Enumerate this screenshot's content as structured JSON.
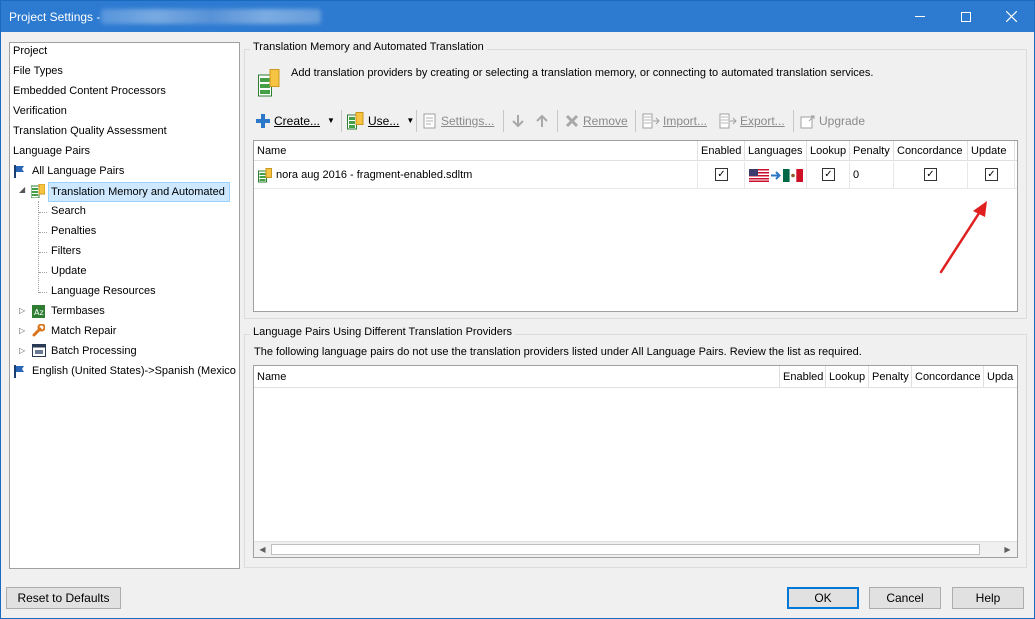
{
  "window": {
    "title": "Project Settings -",
    "colors": {
      "titlebar": "#2d7ad1",
      "accent": "#0078d7",
      "selection": "#cde8ff",
      "arrow": "#e02020"
    }
  },
  "tree": {
    "items": [
      {
        "label": "Project"
      },
      {
        "label": "File Types"
      },
      {
        "label": "Embedded Content Processors"
      },
      {
        "label": "Verification"
      },
      {
        "label": "Translation Quality Assessment"
      },
      {
        "label": "Language Pairs"
      },
      {
        "label": "All Language Pairs"
      },
      {
        "label": "Translation Memory and Automated"
      },
      {
        "label": "Search"
      },
      {
        "label": "Penalties"
      },
      {
        "label": "Filters"
      },
      {
        "label": "Update"
      },
      {
        "label": "Language Resources"
      },
      {
        "label": "Termbases"
      },
      {
        "label": "Match Repair"
      },
      {
        "label": "Batch Processing"
      },
      {
        "label": "English (United States)->Spanish (Mexico"
      }
    ]
  },
  "tm_section": {
    "title": "Translation Memory and Automated Translation",
    "description": "Add translation providers by creating or selecting a translation memory, or connecting to automated translation services."
  },
  "toolbar": {
    "create": "Create...",
    "use": "Use...",
    "settings": "Settings...",
    "remove": "Remove",
    "import": "Import...",
    "export": "Export...",
    "upgrade": "Upgrade"
  },
  "tm_grid": {
    "columns": [
      "Name",
      "Enabled",
      "Languages",
      "Lookup",
      "Penalty",
      "Concordance",
      "Update"
    ],
    "rows": [
      {
        "name": "nora aug 2016 - fragment-enabled.sdltm",
        "enabled": true,
        "lookup": true,
        "penalty": "0",
        "concordance": true,
        "update": true
      }
    ]
  },
  "lp_section": {
    "title": "Language Pairs Using Different Translation Providers",
    "description": "The following language pairs do not use the translation providers listed under All Language Pairs. Review the list as required."
  },
  "lp_grid": {
    "columns": [
      "Name",
      "Enabled",
      "Lookup",
      "Penalty",
      "Concordance",
      "Upda"
    ]
  },
  "footer": {
    "reset": "Reset to Defaults",
    "ok": "OK",
    "cancel": "Cancel",
    "help": "Help"
  }
}
